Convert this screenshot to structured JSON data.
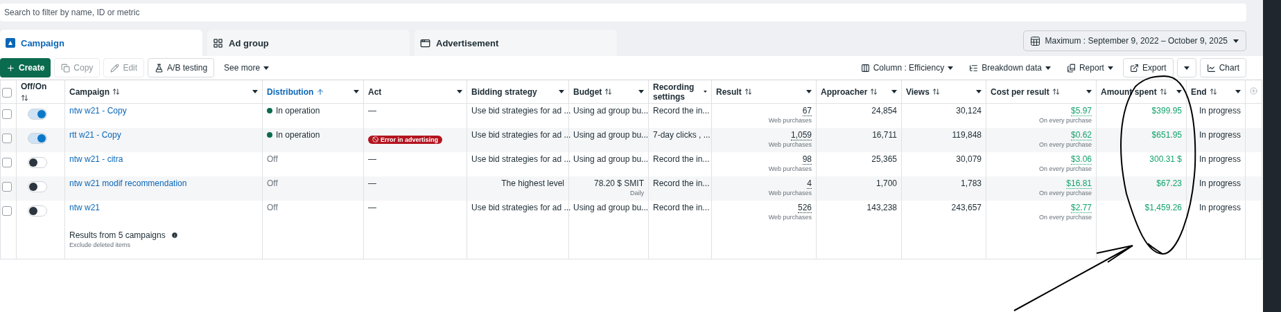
{
  "search": {
    "placeholder": "Search to filter by name, ID or metric"
  },
  "tabs": [
    {
      "label": "Campaign",
      "selected": true
    },
    {
      "label": "Ad group",
      "selected": false
    },
    {
      "label": "Advertisement",
      "selected": false
    }
  ],
  "date_range": {
    "label": "Maximum : September 9, 2022 – October 9, 2025"
  },
  "toolbar_left": [
    {
      "label": "Create",
      "kind": "primary",
      "disabled": false
    },
    {
      "label": "Copy",
      "kind": "plain",
      "disabled": true
    },
    {
      "label": "Edit",
      "kind": "plain",
      "disabled": true
    },
    {
      "label": "A/B testing",
      "kind": "plain",
      "disabled": false
    },
    {
      "label": "See more",
      "kind": "menu",
      "disabled": false
    }
  ],
  "toolbar_right": [
    {
      "label": "Column : Efficiency",
      "kind": "menu"
    },
    {
      "label": "Breakdown data",
      "kind": "menu"
    },
    {
      "label": "Report",
      "kind": "menu"
    },
    {
      "label": "Export",
      "kind": "button"
    },
    {
      "kind": "split"
    },
    {
      "label": "Chart",
      "kind": "button"
    }
  ],
  "table": {
    "all_selected": false,
    "columns": [
      {
        "label": "Off/On",
        "kind": "sortable",
        "selected": false
      },
      {
        "label": "Campaign",
        "kind": "sortable",
        "selected": false
      },
      {
        "label": "Distribution",
        "kind": "sortable",
        "selected": true
      },
      {
        "label": "Act",
        "kind": "plain",
        "selected": false
      },
      {
        "label": "Bidding strategy",
        "kind": "plain",
        "selected": false
      },
      {
        "label": "Budget",
        "kind": "sortable",
        "selected": false
      },
      {
        "label": "Recording settings",
        "kind": "plain",
        "selected": false
      },
      {
        "label": "Result",
        "kind": "sortable",
        "selected": false
      },
      {
        "label": "Approacher",
        "kind": "sortable",
        "selected": false
      },
      {
        "label": "Views",
        "kind": "sortable",
        "selected": false
      },
      {
        "label": "Cost per result",
        "kind": "sortable",
        "selected": false
      },
      {
        "label": "Amount spent",
        "kind": "sortable",
        "selected": false
      },
      {
        "label": "End",
        "kind": "sortable",
        "selected": false
      }
    ],
    "rows": [
      {
        "selected": false,
        "on": true,
        "campaign": "ntw w21 - Copy",
        "distribution": {
          "kind": "active",
          "text": "In operation"
        },
        "act": {
          "kind": "dash",
          "text": "—"
        },
        "bidding": {
          "kind": "text",
          "value": "Use bid strategies for ad ..."
        },
        "budget": {
          "kind": "text",
          "value": "Using ad group bu..."
        },
        "recording": "Record the in...",
        "result": {
          "value": "67",
          "note": "Web purchases"
        },
        "approacher": "24,854",
        "views": "30,124",
        "cost": {
          "value": "$5.97",
          "note": "On every purchase"
        },
        "amount": "$399.95",
        "end": "In progress"
      },
      {
        "selected": false,
        "on": true,
        "campaign": "rtt w21 - Copy",
        "distribution": {
          "kind": "active",
          "text": "In operation"
        },
        "act": {
          "kind": "error",
          "text": "Error in advertising"
        },
        "bidding": {
          "kind": "text",
          "value": "Use bid strategies for ad ..."
        },
        "budget": {
          "kind": "text",
          "value": "Using ad group bu..."
        },
        "recording": "7-day clicks , ...",
        "result": {
          "value": "1,059",
          "note": "Web purchases"
        },
        "approacher": "16,711",
        "views": "119,848",
        "cost": {
          "value": "$0.62",
          "note": "On every purchase"
        },
        "amount": "$651.95",
        "end": "In progress"
      },
      {
        "selected": false,
        "on": false,
        "campaign": "ntw w21 - citra",
        "distribution": {
          "kind": "off",
          "text": "Off"
        },
        "act": {
          "kind": "dash",
          "text": "—"
        },
        "bidding": {
          "kind": "text",
          "value": "Use bid strategies for ad ..."
        },
        "budget": {
          "kind": "text",
          "value": "Using ad group bu..."
        },
        "recording": "Record the in...",
        "result": {
          "value": "98",
          "note": "Web purchases"
        },
        "approacher": "25,365",
        "views": "30,079",
        "cost": {
          "value": "$3.06",
          "note": "On every purchase"
        },
        "amount": "300.31 $",
        "end": "In progress"
      },
      {
        "selected": false,
        "on": false,
        "campaign": "ntw w21 modif recommendation",
        "distribution": {
          "kind": "off",
          "text": "Off"
        },
        "act": {
          "kind": "dash",
          "text": "—"
        },
        "bidding": {
          "kind": "amount",
          "value": "The highest level"
        },
        "budget": {
          "kind": "amount",
          "value": "78.20 $ SMIT",
          "note": "Daily"
        },
        "recording": "Record the in...",
        "result": {
          "value": "4",
          "note": "Web purchases"
        },
        "approacher": "1,700",
        "views": "1,783",
        "cost": {
          "value": "$16.81",
          "note": "On every purchase"
        },
        "amount": "$67.23",
        "end": "In progress"
      },
      {
        "selected": false,
        "on": false,
        "campaign": "ntw w21",
        "distribution": {
          "kind": "off",
          "text": "Off"
        },
        "act": {
          "kind": "dash",
          "text": "—"
        },
        "bidding": {
          "kind": "text",
          "value": "Use bid strategies for ad ..."
        },
        "budget": {
          "kind": "text",
          "value": "Using ad group bu..."
        },
        "recording": "Record the in...",
        "result": {
          "value": "526",
          "note": "Web purchases"
        },
        "approacher": "143,238",
        "views": "243,657",
        "cost": {
          "value": "$2.77",
          "note": "On every purchase"
        },
        "amount": "$1,459.26",
        "end": "In progress"
      }
    ],
    "summary": {
      "title": "Results from 5 campaigns",
      "note": "Exclude deleted items"
    }
  }
}
